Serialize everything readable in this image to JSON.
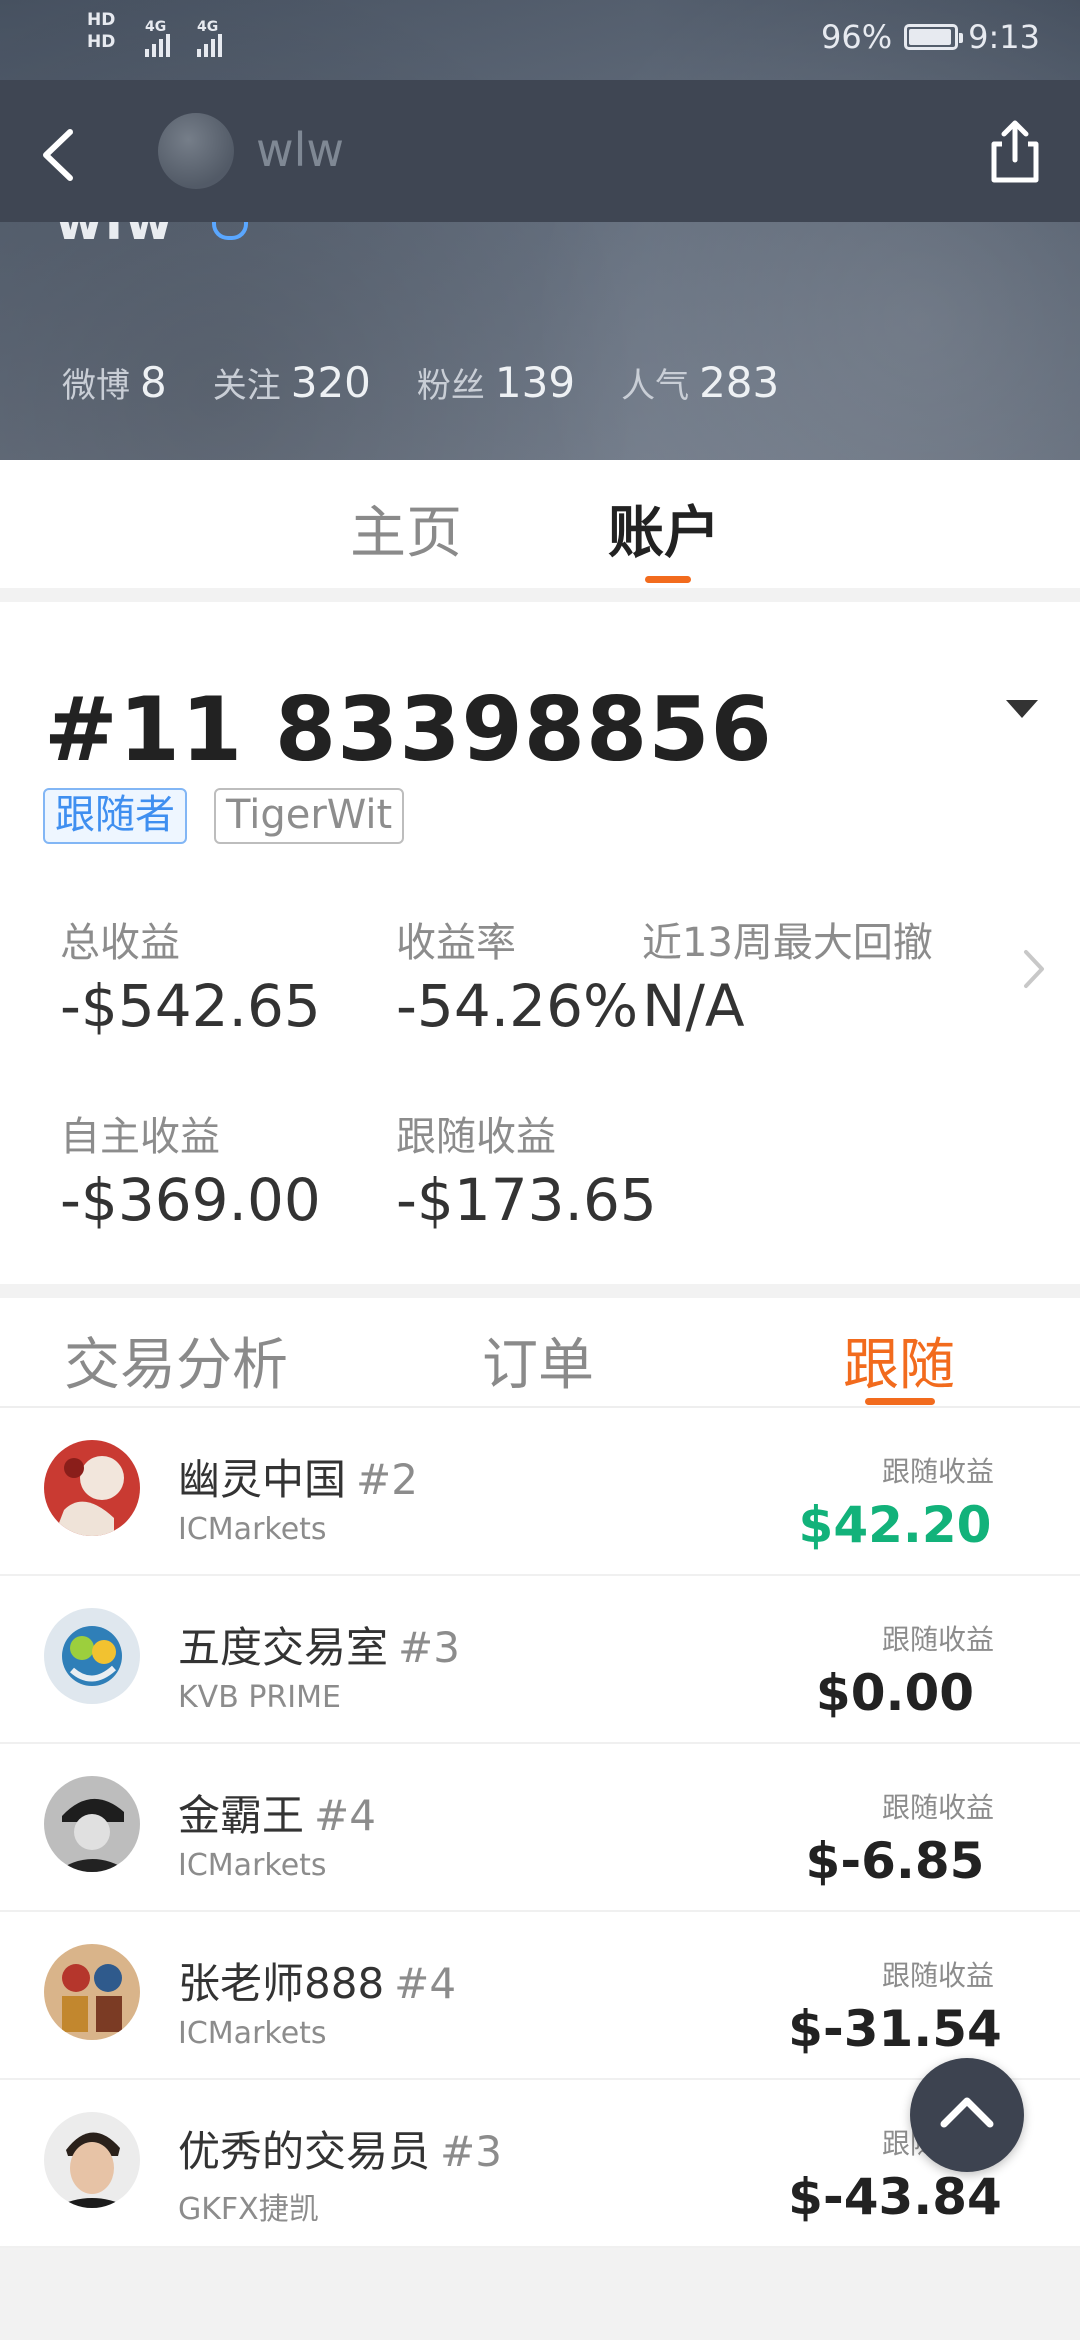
{
  "status_bar": {
    "sim1": "HD",
    "sim2": "HD",
    "net1": "4G",
    "net2": "4G",
    "battery_percent": "96%",
    "battery_level": 0.96,
    "time": "9:13"
  },
  "nav": {
    "username": "wlw",
    "back_icon": "chevron-left-icon",
    "share_icon": "share-icon"
  },
  "profile": {
    "display_name_partial": "wlw",
    "stats": [
      {
        "label": "微博",
        "value": "8"
      },
      {
        "label": "关注",
        "value": "320"
      },
      {
        "label": "粉丝",
        "value": "139"
      },
      {
        "label": "人气",
        "value": "283"
      }
    ]
  },
  "main_tabs": [
    {
      "label": "主页",
      "active": false
    },
    {
      "label": "账户",
      "active": true
    }
  ],
  "account": {
    "number": "#11 83398856",
    "tags": [
      "跟随者",
      "TigerWit"
    ],
    "metrics": {
      "total_profit_label": "总收益",
      "total_profit_value": "-$542.65",
      "return_rate_label": "收益率",
      "return_rate_value": "-54.26%",
      "max_drawdown_label": "近13周最大回撤",
      "max_drawdown_value": "N/A",
      "self_profit_label": "自主收益",
      "self_profit_value": "-$369.00",
      "follow_profit_label": "跟随收益",
      "follow_profit_value": "-$173.65"
    }
  },
  "sub_tabs": [
    {
      "label": "交易分析",
      "active": false
    },
    {
      "label": "订单",
      "active": false
    },
    {
      "label": "跟随",
      "active": true
    }
  ],
  "follow_list": [
    {
      "name": "幽灵中国",
      "rank": "#2",
      "broker": "ICMarkets",
      "profit_label": "跟随收益",
      "profit": "$42.20",
      "positive": true
    },
    {
      "name": "五度交易室",
      "rank": "#3",
      "broker": "KVB PRIME",
      "profit_label": "跟随收益",
      "profit": "$0.00",
      "positive": false
    },
    {
      "name": "金霸王",
      "rank": "#4",
      "broker": "ICMarkets",
      "profit_label": "跟随收益",
      "profit": "$-6.85",
      "positive": false
    },
    {
      "name": "张老师888",
      "rank": "#4",
      "broker": "ICMarkets",
      "profit_label": "跟随收益",
      "profit": "$-31.54",
      "positive": false
    },
    {
      "name": "优秀的交易员",
      "rank": "#3",
      "broker": "GKFX捷凯",
      "profit_label": "跟随收益",
      "profit": "$-43.84",
      "positive": false
    }
  ],
  "colors": {
    "accent": "#f26b1d",
    "positive": "#12b27a",
    "tag_blue": "#3f8ff0",
    "nav_bg": "#3f4653"
  }
}
